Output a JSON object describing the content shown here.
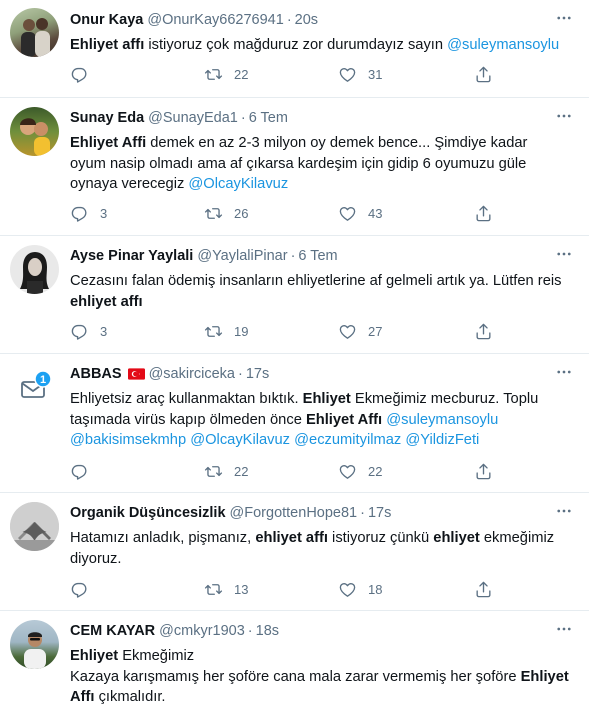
{
  "tweets": [
    {
      "name": "Onur Kaya",
      "handle": "@OnurKay66276941",
      "time": "20s",
      "lines": [
        [
          {
            "t": "Ehliyet affı",
            "b": true
          },
          {
            "t": " istiyoruz çok mağduruz zor durumdayız sayın "
          },
          {
            "t": "@suleymansoylu",
            "l": true
          }
        ]
      ],
      "replies": "",
      "retweets": "22",
      "likes": "31"
    },
    {
      "name": "Sunay Eda",
      "handle": "@SunayEda1",
      "time": "6 Tem",
      "lines": [
        [
          {
            "t": "Ehliyet Affi",
            "b": true
          },
          {
            "t": "  demek en az 2-3 milyon oy demek bence... Şimdiye kadar"
          }
        ],
        [
          {
            "t": "oyum nasip olmadı ama af çıkarsa kardeşim için gidip 6 oyumuzu güle"
          }
        ],
        [
          {
            "t": "oynaya verecegiz "
          },
          {
            "t": "@OlcayKilavuz",
            "l": true
          }
        ]
      ],
      "replies": "3",
      "retweets": "26",
      "likes": "43"
    },
    {
      "name": "Ayse Pinar Yaylali",
      "handle": "@YaylaliPinar",
      "time": "6 Tem",
      "lines": [
        [
          {
            "t": "Cezasını falan ödemiş insanların ehliyetlerine af gelmeli artık ya. Lütfen reis"
          }
        ],
        [
          {
            "t": "ehliyet affı",
            "b": true
          }
        ]
      ],
      "replies": "3",
      "retweets": "19",
      "likes": "27"
    },
    {
      "name": "ABBAS",
      "handle": "@sakirciceka",
      "time": "17s",
      "badge": "1",
      "lines": [
        [
          {
            "t": "Ehliyetsiz araç kullanmaktan bıktık. "
          },
          {
            "t": "Ehliyet",
            "b": true
          },
          {
            "t": " Ekmeğimiz mecburuz. Toplu"
          }
        ],
        [
          {
            "t": "taşımada virüs kapıp ölmeden önce "
          },
          {
            "t": "Ehliyet Affı",
            "b": true
          },
          {
            "t": " "
          },
          {
            "t": "@suleymansoylu",
            "l": true
          }
        ],
        [
          {
            "t": "@bakisimsekmhp",
            "l": true
          },
          {
            "t": " "
          },
          {
            "t": "@OlcayKilavuz",
            "l": true
          },
          {
            "t": " "
          },
          {
            "t": "@eczumityilmaz",
            "l": true
          },
          {
            "t": " "
          },
          {
            "t": "@YildizFeti",
            "l": true
          }
        ]
      ],
      "replies": "",
      "retweets": "22",
      "likes": "22"
    },
    {
      "name": "Organik Düşüncesizlik",
      "handle": "@ForgottenHope81",
      "time": "17s",
      "lines": [
        [
          {
            "t": "Hatamızı anladık, pişmanız, "
          },
          {
            "t": "ehliyet affı",
            "b": true
          },
          {
            "t": " istiyoruz çünkü "
          },
          {
            "t": "ehliyet",
            "b": true
          },
          {
            "t": " ekmeğimiz"
          }
        ],
        [
          {
            "t": "diyoruz."
          }
        ]
      ],
      "replies": "",
      "retweets": "13",
      "likes": "18"
    },
    {
      "name": "CEM KAYAR",
      "handle": "@cmkyr1903",
      "time": "18s",
      "lines": [
        [
          {
            "t": "Ehliyet",
            "b": true
          },
          {
            "t": " Ekmeğimiz"
          }
        ],
        [
          {
            "t": "Kazaya karışmamış her şoföre cana mala zarar vermemiş her şoföre "
          },
          {
            "t": "Ehliyet",
            "b": true
          }
        ],
        [
          {
            "t": "Affı",
            "b": true
          },
          {
            "t": " çıkmalıdır."
          }
        ]
      ],
      "replies": "",
      "retweets": "",
      "likes": ""
    }
  ],
  "colors": {
    "link": "#1b95e0",
    "muted": "#5b7083",
    "border": "#e6ecf0",
    "badge": "#1da1f2"
  },
  "icons": {
    "reply": "reply-icon",
    "retweet": "retweet-icon",
    "like": "heart-icon",
    "share": "share-icon",
    "more": "more-icon",
    "mail": "mail-icon",
    "flag": "turkey-flag-icon"
  }
}
